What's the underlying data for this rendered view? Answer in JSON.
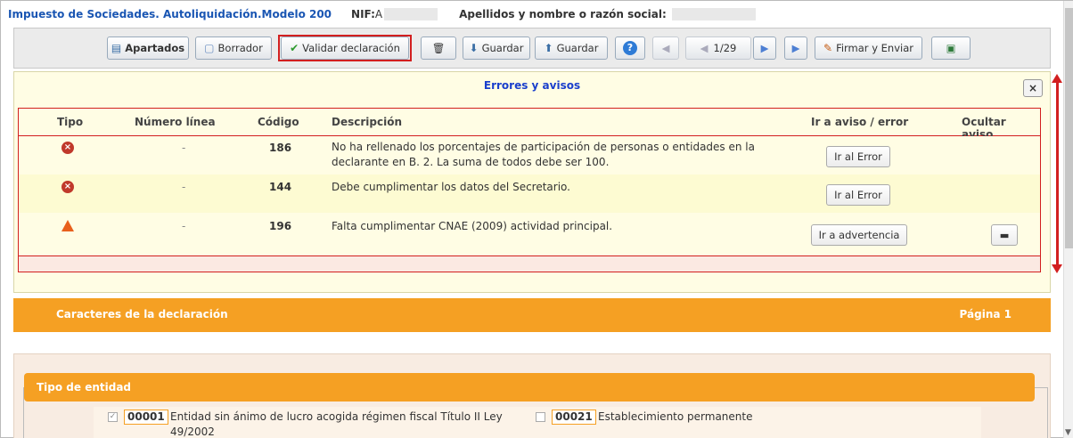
{
  "header": {
    "title": "Impuesto de Sociedades. Autoliquidación.Modelo 200",
    "nif_label": "NIF:",
    "nif_value": "A",
    "name_label": "Apellidos y nombre o razón social:"
  },
  "toolbar": {
    "apartados": "Apartados",
    "borrador": "Borrador",
    "validar": "Validar declaración",
    "guardar1": "Guardar",
    "guardar2": "Guardar",
    "page": "1/29",
    "firmar": "Firmar y Enviar"
  },
  "panel": {
    "title": "Errores y avisos",
    "close": "×",
    "columns": [
      "Tipo",
      "Número línea",
      "Código",
      "Descripción",
      "Ir a aviso / error",
      "Ocultar aviso"
    ],
    "rows": [
      {
        "tipo": "error",
        "linea": "-",
        "codigo": "186",
        "descripcion": "No ha rellenado los porcentajes de participación de personas o entidades en la declarante en B. 2. La suma de todos debe ser 100.",
        "accion": "Ir al Error"
      },
      {
        "tipo": "error",
        "linea": "-",
        "codigo": "144",
        "descripcion": "Debe cumplimentar los datos del Secretario.",
        "accion": "Ir al Error"
      },
      {
        "tipo": "warning",
        "linea": "-",
        "codigo": "196",
        "descripcion": "Falta cumplimentar CNAE (2009) actividad principal.",
        "accion": "Ir a advertencia"
      }
    ]
  },
  "section": {
    "title": "Caracteres de la declaración",
    "page": "Página 1"
  },
  "entidad": {
    "title": "Tipo de entidad",
    "items": [
      {
        "code": "00001",
        "label": "Entidad sin ánimo de lucro acogida régimen fiscal Título II Ley",
        "label2": "49/2002",
        "checked": true
      },
      {
        "code": "00021",
        "label": "Establecimiento permanente",
        "checked": false
      }
    ]
  }
}
